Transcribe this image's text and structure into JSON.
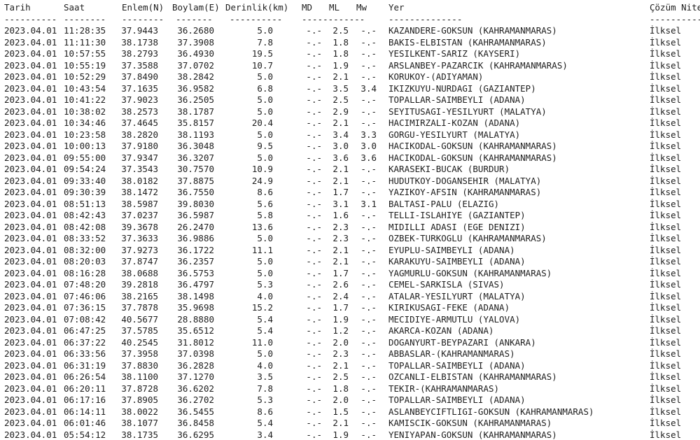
{
  "headers": {
    "date": "Tarih",
    "time": "Saat",
    "lat": "Enlem(N)",
    "lon": "Boylam(E)",
    "depth": "Derinlik(km)",
    "md": "MD",
    "ml": "ML",
    "mw": "Mw",
    "place": "Yer",
    "solution": "Çözüm Niteliği"
  },
  "separators": {
    "date": "----------",
    "time": "--------",
    "lat": "--------",
    "lon": "-------",
    "depth": "----------",
    "mag": "------------",
    "place": "--------------",
    "solution": "------------"
  },
  "rows": [
    {
      "date": "2023.04.01",
      "time": "11:28:35",
      "lat": "37.9443",
      "lon": "36.2680",
      "depth": "5.0",
      "md": "-.-",
      "ml": "2.5",
      "mw": "-.-",
      "place": "KAZANDERE-GOKSUN (KAHRAMANMARAS)",
      "solution": "İlksel"
    },
    {
      "date": "2023.04.01",
      "time": "11:11:30",
      "lat": "38.1738",
      "lon": "37.3908",
      "depth": "7.8",
      "md": "-.-",
      "ml": "1.8",
      "mw": "-.-",
      "place": "BAKIS-ELBISTAN (KAHRAMANMARAS)",
      "solution": "İlksel"
    },
    {
      "date": "2023.04.01",
      "time": "10:57:55",
      "lat": "38.2793",
      "lon": "36.4930",
      "depth": "19.5",
      "md": "-.-",
      "ml": "1.8",
      "mw": "-.-",
      "place": "YESILKENT-SARIZ (KAYSERI)",
      "solution": "İlksel"
    },
    {
      "date": "2023.04.01",
      "time": "10:55:19",
      "lat": "37.3588",
      "lon": "37.0702",
      "depth": "10.7",
      "md": "-.-",
      "ml": "1.9",
      "mw": "-.-",
      "place": "ARSLANBEY-PAZARCIK (KAHRAMANMARAS)",
      "solution": "İlksel"
    },
    {
      "date": "2023.04.01",
      "time": "10:52:29",
      "lat": "37.8490",
      "lon": "38.2842",
      "depth": "5.0",
      "md": "-.-",
      "ml": "2.1",
      "mw": "-.-",
      "place": "KORUKOY-(ADIYAMAN)",
      "solution": "İlksel"
    },
    {
      "date": "2023.04.01",
      "time": "10:43:54",
      "lat": "37.1635",
      "lon": "36.9582",
      "depth": "6.8",
      "md": "-.-",
      "ml": "3.5",
      "mw": "3.4",
      "place": "IKIZKUYU-NURDAGI (GAZIANTEP)",
      "solution": "İlksel"
    },
    {
      "date": "2023.04.01",
      "time": "10:41:22",
      "lat": "37.9023",
      "lon": "36.2505",
      "depth": "5.0",
      "md": "-.-",
      "ml": "2.5",
      "mw": "-.-",
      "place": "TOPALLAR-SAIMBEYLI (ADANA)",
      "solution": "İlksel"
    },
    {
      "date": "2023.04.01",
      "time": "10:38:02",
      "lat": "38.2573",
      "lon": "38.1787",
      "depth": "5.0",
      "md": "-.-",
      "ml": "2.9",
      "mw": "-.-",
      "place": "SEYITUSAGI-YESILYURT (MALATYA)",
      "solution": "İlksel"
    },
    {
      "date": "2023.04.01",
      "time": "10:34:46",
      "lat": "37.4645",
      "lon": "35.8157",
      "depth": "20.4",
      "md": "-.-",
      "ml": "2.1",
      "mw": "-.-",
      "place": "HACIMIRZALI-KOZAN (ADANA)",
      "solution": "İlksel"
    },
    {
      "date": "2023.04.01",
      "time": "10:23:58",
      "lat": "38.2820",
      "lon": "38.1193",
      "depth": "5.0",
      "md": "-.-",
      "ml": "3.4",
      "mw": "3.3",
      "place": "GORGU-YESILYURT (MALATYA)",
      "solution": "İlksel"
    },
    {
      "date": "2023.04.01",
      "time": "10:00:13",
      "lat": "37.9180",
      "lon": "36.3048",
      "depth": "9.5",
      "md": "-.-",
      "ml": "3.0",
      "mw": "3.0",
      "place": "HACIKODAL-GOKSUN (KAHRAMANMARAS)",
      "solution": "İlksel"
    },
    {
      "date": "2023.04.01",
      "time": "09:55:00",
      "lat": "37.9347",
      "lon": "36.3207",
      "depth": "5.0",
      "md": "-.-",
      "ml": "3.6",
      "mw": "3.6",
      "place": "HACIKODAL-GOKSUN (KAHRAMANMARAS)",
      "solution": "İlksel"
    },
    {
      "date": "2023.04.01",
      "time": "09:54:24",
      "lat": "37.3543",
      "lon": "30.7570",
      "depth": "10.9",
      "md": "-.-",
      "ml": "2.1",
      "mw": "-.-",
      "place": "KARASEKI-BUCAK (BURDUR)",
      "solution": "İlksel"
    },
    {
      "date": "2023.04.01",
      "time": "09:33:40",
      "lat": "38.0182",
      "lon": "37.8875",
      "depth": "24.9",
      "md": "-.-",
      "ml": "2.1",
      "mw": "-.-",
      "place": "HUDUTKOY-DOGANSEHIR (MALATYA)",
      "solution": "İlksel"
    },
    {
      "date": "2023.04.01",
      "time": "09:30:39",
      "lat": "38.1472",
      "lon": "36.7550",
      "depth": "8.6",
      "md": "-.-",
      "ml": "1.7",
      "mw": "-.-",
      "place": "YAZIKOY-AFSIN (KAHRAMANMARAS)",
      "solution": "İlksel"
    },
    {
      "date": "2023.04.01",
      "time": "08:51:13",
      "lat": "38.5987",
      "lon": "39.8030",
      "depth": "5.6",
      "md": "-.-",
      "ml": "3.1",
      "mw": "3.1",
      "place": "BALTASI-PALU (ELAZIG)",
      "solution": "İlksel"
    },
    {
      "date": "2023.04.01",
      "time": "08:42:43",
      "lat": "37.0237",
      "lon": "36.5987",
      "depth": "5.8",
      "md": "-.-",
      "ml": "1.6",
      "mw": "-.-",
      "place": "TELLI-ISLAHIYE (GAZIANTEP)",
      "solution": "İlksel"
    },
    {
      "date": "2023.04.01",
      "time": "08:42:08",
      "lat": "39.3678",
      "lon": "26.2470",
      "depth": "13.6",
      "md": "-.-",
      "ml": "2.3",
      "mw": "-.-",
      "place": "MIDILLI ADASI (EGE DENIZI)",
      "solution": "İlksel"
    },
    {
      "date": "2023.04.01",
      "time": "08:33:52",
      "lat": "37.3633",
      "lon": "36.9886",
      "depth": "5.0",
      "md": "-.-",
      "ml": "2.3",
      "mw": "-.-",
      "place": "OZBEK-TURKOGLU (KAHRAMANMARAS)",
      "solution": "İlksel"
    },
    {
      "date": "2023.04.01",
      "time": "08:32:00",
      "lat": "37.9273",
      "lon": "36.1722",
      "depth": "11.1",
      "md": "-.-",
      "ml": "2.1",
      "mw": "-.-",
      "place": "EYUPLU-SAIMBEYLI (ADANA)",
      "solution": "İlksel"
    },
    {
      "date": "2023.04.01",
      "time": "08:20:03",
      "lat": "37.8747",
      "lon": "36.2357",
      "depth": "5.0",
      "md": "-.-",
      "ml": "2.1",
      "mw": "-.-",
      "place": "KARAKUYU-SAIMBEYLI (ADANA)",
      "solution": "İlksel"
    },
    {
      "date": "2023.04.01",
      "time": "08:16:28",
      "lat": "38.0688",
      "lon": "36.5753",
      "depth": "5.0",
      "md": "-.-",
      "ml": "1.7",
      "mw": "-.-",
      "place": "YAGMURLU-GOKSUN (KAHRAMANMARAS)",
      "solution": "İlksel"
    },
    {
      "date": "2023.04.01",
      "time": "07:48:20",
      "lat": "39.2818",
      "lon": "36.4797",
      "depth": "5.3",
      "md": "-.-",
      "ml": "2.6",
      "mw": "-.-",
      "place": "CEMEL-SARKISLA (SIVAS)",
      "solution": "İlksel"
    },
    {
      "date": "2023.04.01",
      "time": "07:46:06",
      "lat": "38.2165",
      "lon": "38.1498",
      "depth": "4.0",
      "md": "-.-",
      "ml": "2.4",
      "mw": "-.-",
      "place": "ATALAR-YESILYURT (MALATYA)",
      "solution": "İlksel"
    },
    {
      "date": "2023.04.01",
      "time": "07:36:15",
      "lat": "37.7878",
      "lon": "35.9698",
      "depth": "15.2",
      "md": "-.-",
      "ml": "1.7",
      "mw": "-.-",
      "place": "KIRIKUSAGI-FEKE (ADANA)",
      "solution": "İlksel"
    },
    {
      "date": "2023.04.01",
      "time": "07:08:42",
      "lat": "40.5677",
      "lon": "28.8880",
      "depth": "5.4",
      "md": "-.-",
      "ml": "1.9",
      "mw": "-.-",
      "place": "MECIDIYE-ARMUTLU (YALOVA)",
      "solution": "İlksel"
    },
    {
      "date": "2023.04.01",
      "time": "06:47:25",
      "lat": "37.5785",
      "lon": "35.6512",
      "depth": "5.4",
      "md": "-.-",
      "ml": "1.2",
      "mw": "-.-",
      "place": "AKARCA-KOZAN (ADANA)",
      "solution": "İlksel"
    },
    {
      "date": "2023.04.01",
      "time": "06:37:22",
      "lat": "40.2545",
      "lon": "31.8012",
      "depth": "11.0",
      "md": "-.-",
      "ml": "2.0",
      "mw": "-.-",
      "place": "DOGANYURT-BEYPAZARI (ANKARA)",
      "solution": "İlksel"
    },
    {
      "date": "2023.04.01",
      "time": "06:33:56",
      "lat": "37.3958",
      "lon": "37.0398",
      "depth": "5.0",
      "md": "-.-",
      "ml": "2.3",
      "mw": "-.-",
      "place": "ABBASLAR-(KAHRAMANMARAS)",
      "solution": "İlksel"
    },
    {
      "date": "2023.04.01",
      "time": "06:31:19",
      "lat": "37.8830",
      "lon": "36.2828",
      "depth": "4.0",
      "md": "-.-",
      "ml": "2.1",
      "mw": "-.-",
      "place": "TOPALLAR-SAIMBEYLI (ADANA)",
      "solution": "İlksel"
    },
    {
      "date": "2023.04.01",
      "time": "06:26:54",
      "lat": "38.1100",
      "lon": "37.1270",
      "depth": "3.5",
      "md": "-.-",
      "ml": "2.5",
      "mw": "-.-",
      "place": "OZCANLI-ELBISTAN (KAHRAMANMARAS)",
      "solution": "İlksel"
    },
    {
      "date": "2023.04.01",
      "time": "06:20:11",
      "lat": "37.8728",
      "lon": "36.6202",
      "depth": "7.8",
      "md": "-.-",
      "ml": "1.8",
      "mw": "-.-",
      "place": "TEKIR-(KAHRAMANMARAS)",
      "solution": "İlksel"
    },
    {
      "date": "2023.04.01",
      "time": "06:17:16",
      "lat": "37.8905",
      "lon": "36.2702",
      "depth": "5.3",
      "md": "-.-",
      "ml": "2.0",
      "mw": "-.-",
      "place": "TOPALLAR-SAIMBEYLI (ADANA)",
      "solution": "İlksel"
    },
    {
      "date": "2023.04.01",
      "time": "06:14:11",
      "lat": "38.0022",
      "lon": "36.5455",
      "depth": "8.6",
      "md": "-.-",
      "ml": "1.5",
      "mw": "-.-",
      "place": "ASLANBEYCIFTLIGI-GOKSUN (KAHRAMANMARAS)",
      "solution": "İlksel"
    },
    {
      "date": "2023.04.01",
      "time": "06:01:46",
      "lat": "38.1077",
      "lon": "36.8458",
      "depth": "5.4",
      "md": "-.-",
      "ml": "2.1",
      "mw": "-.-",
      "place": "KAMISCIK-GOKSUN (KAHRAMANMARAS)",
      "solution": "İlksel"
    },
    {
      "date": "2023.04.01",
      "time": "05:54:12",
      "lat": "38.1735",
      "lon": "36.6295",
      "depth": "3.4",
      "md": "-.-",
      "ml": "1.9",
      "mw": "-.-",
      "place": "YENIYAPAN-GOKSUN (KAHRAMANMARAS)",
      "solution": "İlksel"
    }
  ]
}
